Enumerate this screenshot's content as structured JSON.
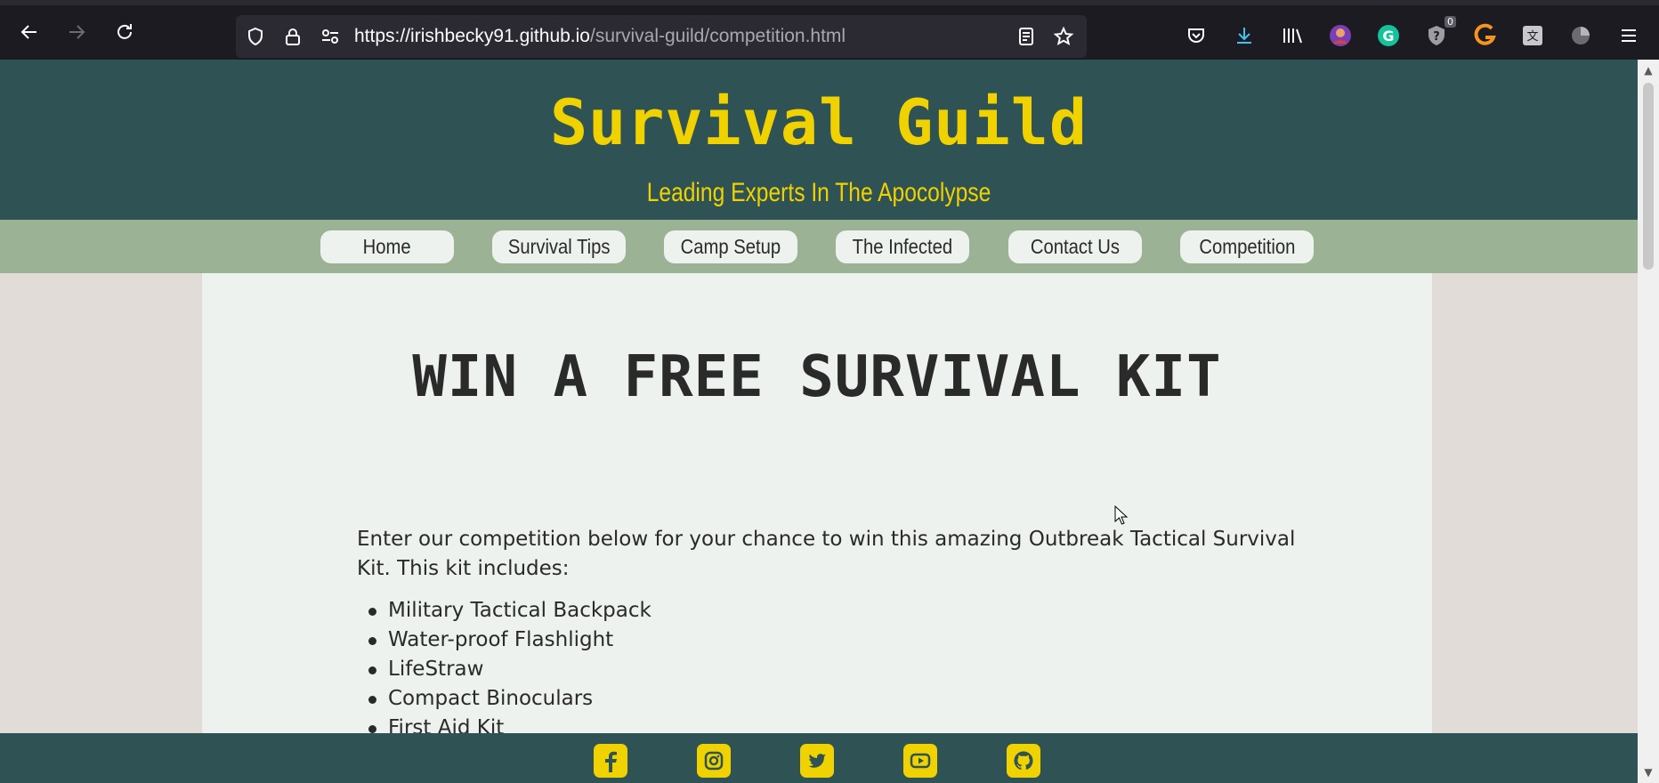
{
  "browser": {
    "url_host": "https://irishbecky91.github.io",
    "url_path": "/survival-guild/competition.html",
    "badge_count": "0",
    "icons": [
      "back-icon",
      "forward-icon",
      "reload-icon",
      "shield-icon",
      "lock-icon",
      "permissions-icon",
      "reader-view-icon",
      "bookmark-star-icon",
      "pocket-icon",
      "downloads-icon",
      "library-icon",
      "profile-icon",
      "grammarly-icon",
      "extension-help-icon",
      "extension-orange-icon",
      "extension-translate-icon",
      "extension-stats-icon",
      "menu-icon"
    ]
  },
  "site": {
    "title": "Survival Guild",
    "subtitle": "Leading Experts In The Apocolypse",
    "colors": {
      "header_bg": "#2f5254",
      "accent": "#f0d200",
      "nav_bg": "#9cb294",
      "content_bg": "#eef2ee",
      "page_bg": "#e2dcd9"
    }
  },
  "nav": {
    "items": [
      {
        "label": "Home"
      },
      {
        "label": "Survival Tips"
      },
      {
        "label": "Camp Setup"
      },
      {
        "label": "The Infected"
      },
      {
        "label": "Contact Us"
      },
      {
        "label": "Competition"
      }
    ]
  },
  "main": {
    "heading": "WIN A FREE SURVIVAL KIT",
    "intro": "Enter our competition below for your chance to win this amazing Outbreak Tactical Survival Kit. This kit includes:",
    "kit_items": [
      "Military Tactical Backpack",
      "Water-proof Flashlight",
      "LifeStraw",
      "Compact Binoculars",
      "First Aid Kit"
    ]
  },
  "footer": {
    "social_icons": [
      "facebook-icon",
      "instagram-icon",
      "twitter-icon",
      "youtube-icon",
      "github-icon"
    ]
  }
}
